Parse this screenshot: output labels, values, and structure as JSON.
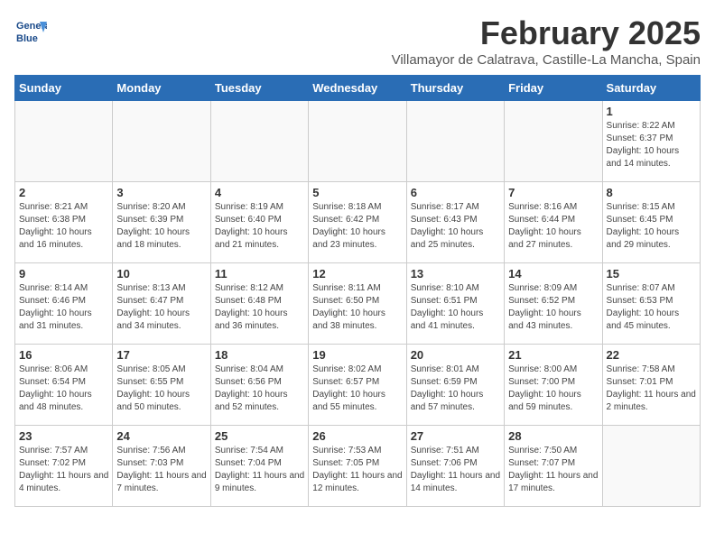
{
  "logo": {
    "line1": "General",
    "line2": "Blue"
  },
  "title": "February 2025",
  "subtitle": "Villamayor de Calatrava, Castille-La Mancha, Spain",
  "weekdays": [
    "Sunday",
    "Monday",
    "Tuesday",
    "Wednesday",
    "Thursday",
    "Friday",
    "Saturday"
  ],
  "weeks": [
    [
      {
        "day": "",
        "info": ""
      },
      {
        "day": "",
        "info": ""
      },
      {
        "day": "",
        "info": ""
      },
      {
        "day": "",
        "info": ""
      },
      {
        "day": "",
        "info": ""
      },
      {
        "day": "",
        "info": ""
      },
      {
        "day": "1",
        "info": "Sunrise: 8:22 AM\nSunset: 6:37 PM\nDaylight: 10 hours and 14 minutes."
      }
    ],
    [
      {
        "day": "2",
        "info": "Sunrise: 8:21 AM\nSunset: 6:38 PM\nDaylight: 10 hours and 16 minutes."
      },
      {
        "day": "3",
        "info": "Sunrise: 8:20 AM\nSunset: 6:39 PM\nDaylight: 10 hours and 18 minutes."
      },
      {
        "day": "4",
        "info": "Sunrise: 8:19 AM\nSunset: 6:40 PM\nDaylight: 10 hours and 21 minutes."
      },
      {
        "day": "5",
        "info": "Sunrise: 8:18 AM\nSunset: 6:42 PM\nDaylight: 10 hours and 23 minutes."
      },
      {
        "day": "6",
        "info": "Sunrise: 8:17 AM\nSunset: 6:43 PM\nDaylight: 10 hours and 25 minutes."
      },
      {
        "day": "7",
        "info": "Sunrise: 8:16 AM\nSunset: 6:44 PM\nDaylight: 10 hours and 27 minutes."
      },
      {
        "day": "8",
        "info": "Sunrise: 8:15 AM\nSunset: 6:45 PM\nDaylight: 10 hours and 29 minutes."
      }
    ],
    [
      {
        "day": "9",
        "info": "Sunrise: 8:14 AM\nSunset: 6:46 PM\nDaylight: 10 hours and 31 minutes."
      },
      {
        "day": "10",
        "info": "Sunrise: 8:13 AM\nSunset: 6:47 PM\nDaylight: 10 hours and 34 minutes."
      },
      {
        "day": "11",
        "info": "Sunrise: 8:12 AM\nSunset: 6:48 PM\nDaylight: 10 hours and 36 minutes."
      },
      {
        "day": "12",
        "info": "Sunrise: 8:11 AM\nSunset: 6:50 PM\nDaylight: 10 hours and 38 minutes."
      },
      {
        "day": "13",
        "info": "Sunrise: 8:10 AM\nSunset: 6:51 PM\nDaylight: 10 hours and 41 minutes."
      },
      {
        "day": "14",
        "info": "Sunrise: 8:09 AM\nSunset: 6:52 PM\nDaylight: 10 hours and 43 minutes."
      },
      {
        "day": "15",
        "info": "Sunrise: 8:07 AM\nSunset: 6:53 PM\nDaylight: 10 hours and 45 minutes."
      }
    ],
    [
      {
        "day": "16",
        "info": "Sunrise: 8:06 AM\nSunset: 6:54 PM\nDaylight: 10 hours and 48 minutes."
      },
      {
        "day": "17",
        "info": "Sunrise: 8:05 AM\nSunset: 6:55 PM\nDaylight: 10 hours and 50 minutes."
      },
      {
        "day": "18",
        "info": "Sunrise: 8:04 AM\nSunset: 6:56 PM\nDaylight: 10 hours and 52 minutes."
      },
      {
        "day": "19",
        "info": "Sunrise: 8:02 AM\nSunset: 6:57 PM\nDaylight: 10 hours and 55 minutes."
      },
      {
        "day": "20",
        "info": "Sunrise: 8:01 AM\nSunset: 6:59 PM\nDaylight: 10 hours and 57 minutes."
      },
      {
        "day": "21",
        "info": "Sunrise: 8:00 AM\nSunset: 7:00 PM\nDaylight: 10 hours and 59 minutes."
      },
      {
        "day": "22",
        "info": "Sunrise: 7:58 AM\nSunset: 7:01 PM\nDaylight: 11 hours and 2 minutes."
      }
    ],
    [
      {
        "day": "23",
        "info": "Sunrise: 7:57 AM\nSunset: 7:02 PM\nDaylight: 11 hours and 4 minutes."
      },
      {
        "day": "24",
        "info": "Sunrise: 7:56 AM\nSunset: 7:03 PM\nDaylight: 11 hours and 7 minutes."
      },
      {
        "day": "25",
        "info": "Sunrise: 7:54 AM\nSunset: 7:04 PM\nDaylight: 11 hours and 9 minutes."
      },
      {
        "day": "26",
        "info": "Sunrise: 7:53 AM\nSunset: 7:05 PM\nDaylight: 11 hours and 12 minutes."
      },
      {
        "day": "27",
        "info": "Sunrise: 7:51 AM\nSunset: 7:06 PM\nDaylight: 11 hours and 14 minutes."
      },
      {
        "day": "28",
        "info": "Sunrise: 7:50 AM\nSunset: 7:07 PM\nDaylight: 11 hours and 17 minutes."
      },
      {
        "day": "",
        "info": ""
      }
    ]
  ]
}
